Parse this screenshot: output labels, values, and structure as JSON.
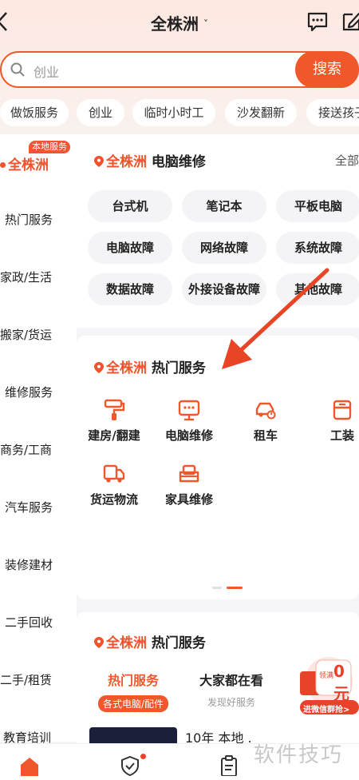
{
  "header": {
    "city": "全株洲",
    "caret": "˅",
    "search_placeholder": "创业",
    "search_button": "搜索"
  },
  "chips": [
    "做饭服务",
    "创业",
    "临时小时工",
    "沙发翻新",
    "接送孩子"
  ],
  "leftnav": {
    "badge": "本地服务",
    "city": "全株洲",
    "items": [
      "热门服务",
      "家政/生活",
      "搬家/货运",
      "维修服务",
      "商务/工商",
      "汽车服务",
      "装修建材",
      "二手回收",
      "二手/租赁",
      "教育培训"
    ]
  },
  "card1": {
    "city": "全株洲",
    "title": "电脑维修",
    "more": "全部",
    "pills": [
      "台式机",
      "笔记本",
      "平板电脑",
      "电脑故障",
      "网络故障",
      "系统故障",
      "数据故障",
      "外接设备故障",
      "其他故障"
    ]
  },
  "card2": {
    "city": "全株洲",
    "title": "热门服务",
    "services": [
      {
        "label": "建房/翻建",
        "icon": "paint-roller-icon"
      },
      {
        "label": "电脑维修",
        "icon": "monitor-icon"
      },
      {
        "label": "租车",
        "icon": "car-icon"
      },
      {
        "label": "工装",
        "icon": "box-icon"
      },
      {
        "label": "货运物流",
        "icon": "truck-icon"
      },
      {
        "label": "家具维修",
        "icon": "sofa-icon"
      }
    ]
  },
  "card3": {
    "city": "全株洲",
    "title": "热门服务",
    "tabs": [
      {
        "title": "热门服务",
        "sub": "各式电脑/配件"
      },
      {
        "title": "大家都在看",
        "sub": "发现好服务"
      }
    ],
    "snippet": "10年 本地 .",
    "promo": {
      "text1": "领满",
      "amount": "0元",
      "cta": "进微信群抢>"
    }
  },
  "watermark": "软件技巧",
  "colors": {
    "accent": "#f0572b",
    "text": "#222222"
  }
}
